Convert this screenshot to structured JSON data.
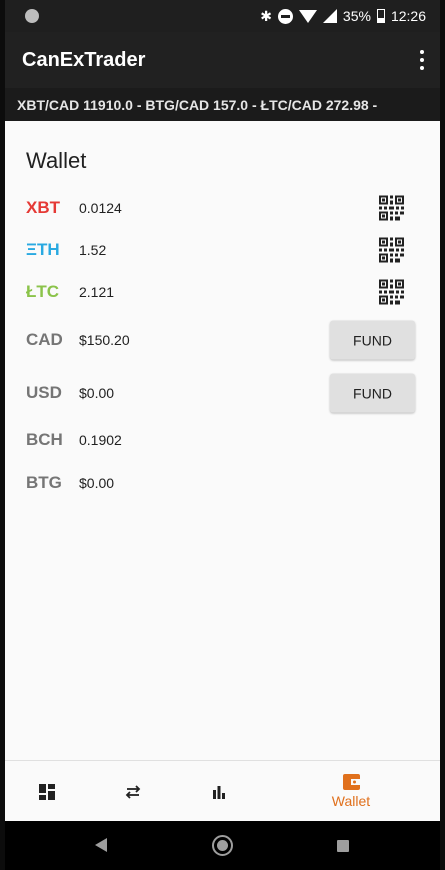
{
  "status_bar": {
    "battery_percent": "35%",
    "time": "12:26",
    "icons": [
      "record-dot-icon",
      "bluetooth-icon",
      "do-not-disturb-icon",
      "wifi-icon",
      "signal-icon",
      "battery-icon"
    ]
  },
  "app_bar": {
    "title": "CanExTrader",
    "overflow_icon": "more-vert-icon"
  },
  "ticker": {
    "text": "XBT/CAD 11910.0  -  BTG/CAD 157.0  -  ŁTC/CAD 272.98  -"
  },
  "wallet": {
    "title": "Wallet",
    "rows": [
      {
        "symbol": "XBT",
        "amount": "0.0124",
        "color": "#e53935",
        "action": "qr-code-icon"
      },
      {
        "symbol": "ΞTH",
        "amount": "1.52",
        "color": "#29a9e1",
        "action": "qr-code-icon"
      },
      {
        "symbol": "ŁTC",
        "amount": "2.121",
        "color": "#8bc34a",
        "action": "qr-code-icon"
      },
      {
        "symbol": "CAD",
        "amount": "$150.20",
        "color": "#757575",
        "action_label": "FUND"
      },
      {
        "symbol": "USD",
        "amount": "$0.00",
        "color": "#757575",
        "action_label": "FUND"
      },
      {
        "symbol": "BCH",
        "amount": "0.1902",
        "color": "#757575"
      },
      {
        "symbol": "BTG",
        "amount": "$0.00",
        "color": "#757575"
      }
    ]
  },
  "bottom_nav": {
    "items": [
      {
        "icon": "dashboard-icon"
      },
      {
        "icon": "swap-icon"
      },
      {
        "icon": "bar-chart-icon"
      },
      {
        "icon": "wallet-icon",
        "label": "Wallet",
        "active": true
      }
    ],
    "active_color": "#e0701c"
  },
  "system_nav": [
    "back-icon",
    "home-icon",
    "recents-icon"
  ]
}
